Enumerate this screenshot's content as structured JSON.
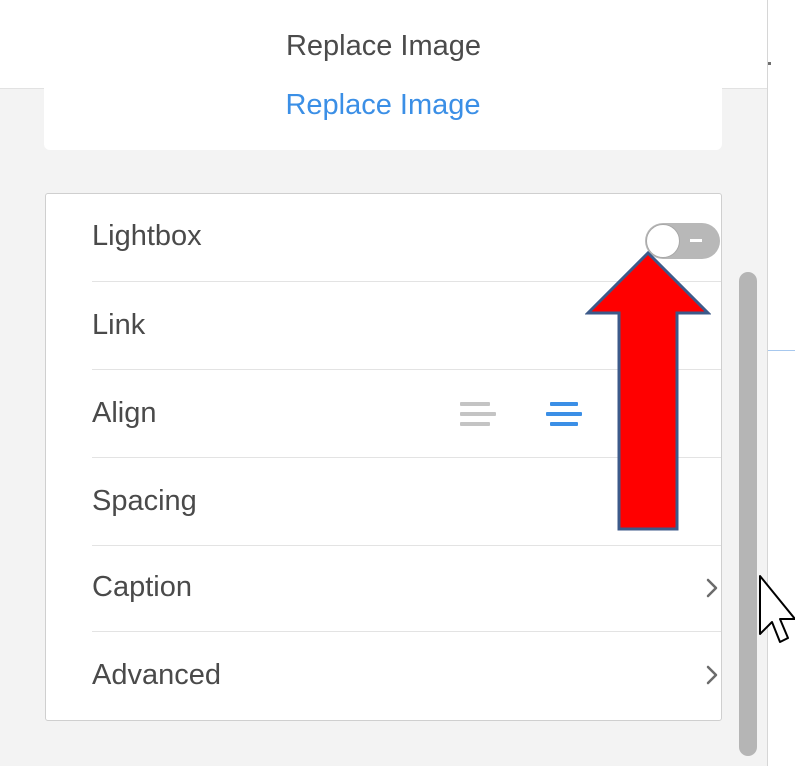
{
  "header": {
    "title": "Replace Image"
  },
  "replace_card": {
    "link_label": "Replace Image"
  },
  "settings": {
    "rows": [
      {
        "label": "Lightbox",
        "control": "toggle",
        "toggle_on": false
      },
      {
        "label": "Link",
        "control": "none"
      },
      {
        "label": "Align",
        "control": "align-options",
        "selected_alignment": "center"
      },
      {
        "label": "Spacing",
        "control": "none"
      },
      {
        "label": "Caption",
        "control": "chevron-right-icon"
      },
      {
        "label": "Advanced",
        "control": "chevron-right-icon"
      }
    ]
  },
  "align_options": [
    {
      "name": "align-left-icon",
      "color": "#c4c4c4"
    },
    {
      "name": "align-center-icon",
      "color": "#3b8fe6"
    }
  ],
  "annotation": {
    "arrow_icon": "red-up-arrow-icon",
    "arrow_color": "#ff0000",
    "arrow_border_color": "#3c5a8a"
  },
  "colors": {
    "accent": "#3b8fe6",
    "text": "#4a4a4a",
    "panel_background": "#f3f3f3",
    "toggle_off": "#b8b8b8"
  },
  "cursor_icon": "mouse-pointer-icon"
}
